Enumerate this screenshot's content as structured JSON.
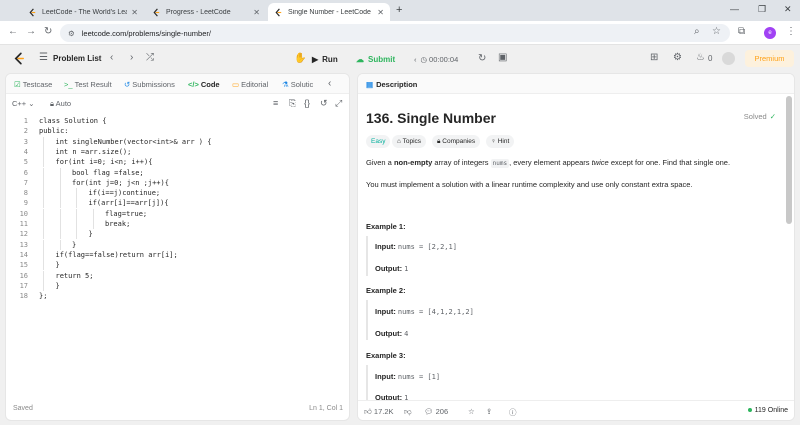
{
  "browser": {
    "tabs": [
      {
        "title": "LeetCode - The World's Leadin",
        "active": false
      },
      {
        "title": "Progress - LeetCode",
        "active": false
      },
      {
        "title": "Single Number - LeetCode",
        "active": true
      }
    ],
    "new_tab": "+",
    "url": "leetcode.com/problems/single-number/",
    "profile_initial": "e"
  },
  "toolbar": {
    "problem_list_label": "Problem List",
    "run_label": "Run",
    "submit_label": "Submit",
    "timer": "00:00:04",
    "streak_count": "0",
    "premium_label": "Premium"
  },
  "left_tabs": [
    {
      "label": "Testcase"
    },
    {
      "label": "Test Result"
    },
    {
      "label": "Submissions"
    },
    {
      "label": "Code"
    },
    {
      "label": "Editorial"
    },
    {
      "label": "Solutic"
    }
  ],
  "editor": {
    "language": "C++",
    "mode": "Auto",
    "lines": [
      {
        "n": "1",
        "text": "class Solution {",
        "indent": 0
      },
      {
        "n": "2",
        "text": "public:",
        "indent": 0
      },
      {
        "n": "3",
        "text": "int singleNumber(vector<int>& arr ) {",
        "indent": 1
      },
      {
        "n": "4",
        "text": "int n =arr.size();",
        "indent": 1
      },
      {
        "n": "5",
        "text": "for(int i=0; i<n; i++){",
        "indent": 1
      },
      {
        "n": "6",
        "text": "bool flag =false;",
        "indent": 2
      },
      {
        "n": "7",
        "text": "for(int j=0; j<n ;j++){",
        "indent": 2
      },
      {
        "n": "8",
        "text": "if(i==j)continue;",
        "indent": 3
      },
      {
        "n": "9",
        "text": "if(arr[i]==arr[j]){",
        "indent": 3
      },
      {
        "n": "10",
        "text": "flag=true;",
        "indent": 4
      },
      {
        "n": "11",
        "text": "break;",
        "indent": 4
      },
      {
        "n": "12",
        "text": "}",
        "indent": 3
      },
      {
        "n": "13",
        "text": "}",
        "indent": 2
      },
      {
        "n": "14",
        "text": "if(flag==false)return arr[i];",
        "indent": 1
      },
      {
        "n": "15",
        "text": "}",
        "indent": 1
      },
      {
        "n": "16",
        "text": "return 5;",
        "indent": 1
      },
      {
        "n": "17",
        "text": "}",
        "indent": 1
      },
      {
        "n": "18",
        "text": "};",
        "indent": 0
      }
    ],
    "status_saved": "Saved",
    "cursor_pos": "Ln 1, Col 1"
  },
  "description": {
    "tab_label": "Description",
    "title": "136. Single Number",
    "solved_label": "Solved",
    "tags": [
      {
        "label": "Easy"
      },
      {
        "label": "Topics"
      },
      {
        "label": "Companies"
      },
      {
        "label": "Hint"
      }
    ],
    "para1": {
      "p1": "Given a ",
      "bold": "non-empty",
      "p2": " array of integers ",
      "code": "nums",
      "p3": ", every element appears ",
      "em": "twice",
      "p4": " except for one. Find that single one."
    },
    "para2": "You must implement a solution with a linear runtime complexity and use only constant extra space.",
    "examples": [
      {
        "heading": "Example 1:",
        "input_label": "Input:",
        "input": "nums = [2,2,1]",
        "output_label": "Output:",
        "output": "1"
      },
      {
        "heading": "Example 2:",
        "input_label": "Input:",
        "input": "nums = [4,1,2,1,2]",
        "output_label": "Output:",
        "output": "4"
      },
      {
        "heading": "Example 3:",
        "input_label": "Input:",
        "input": "nums = [1]",
        "output_label": "Output:",
        "output": "1"
      }
    ],
    "footer": {
      "likes": "17.2K",
      "comments": "206",
      "online": "119 Online"
    }
  }
}
